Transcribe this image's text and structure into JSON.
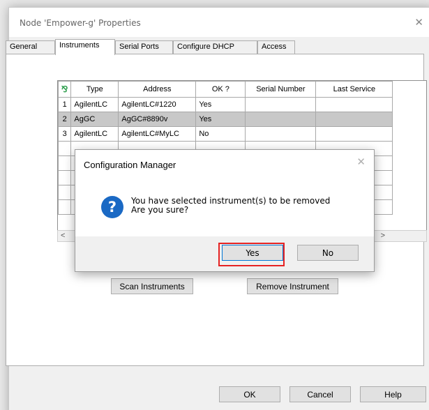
{
  "window": {
    "title": "Node 'Empower-g' Properties",
    "close_glyph": "✕"
  },
  "tabs": [
    {
      "label": "General"
    },
    {
      "label": "Instruments"
    },
    {
      "label": "Serial Ports"
    },
    {
      "label": "Configure DHCP"
    },
    {
      "label": "Access"
    }
  ],
  "active_tab": "Instruments",
  "grid": {
    "corner_icon": "instrument-icon",
    "columns": [
      "Type",
      "Address",
      "OK ?",
      "Serial Number",
      "Last Service"
    ],
    "rows": [
      {
        "num": "1",
        "type": "AgilentLC",
        "address": "AgilentLC#1220",
        "ok": "Yes",
        "serial": "",
        "last_service": ""
      },
      {
        "num": "2",
        "type": "AgGC",
        "address": "AgGC#8890v",
        "ok": "Yes",
        "serial": "",
        "last_service": ""
      },
      {
        "num": "3",
        "type": "AgilentLC",
        "address": "AgilentLC#MyLC",
        "ok": "No",
        "serial": "",
        "last_service": ""
      }
    ],
    "selected_row": 2
  },
  "buttons": {
    "scan": "Scan Instruments",
    "remove": "Remove Instrument",
    "ok": "OK",
    "cancel": "Cancel",
    "help": "Help"
  },
  "dialog": {
    "title": "Configuration Manager",
    "close_glyph": "✕",
    "icon": "question-icon",
    "icon_glyph": "?",
    "message_line1": "You have selected instrument(s) to be removed",
    "message_line2": "Are you sure?",
    "yes": "Yes",
    "no": "No"
  },
  "colors": {
    "highlight": "#e52222",
    "question_icon": "#1a69c4",
    "selected_row": "#c8c8c8"
  }
}
